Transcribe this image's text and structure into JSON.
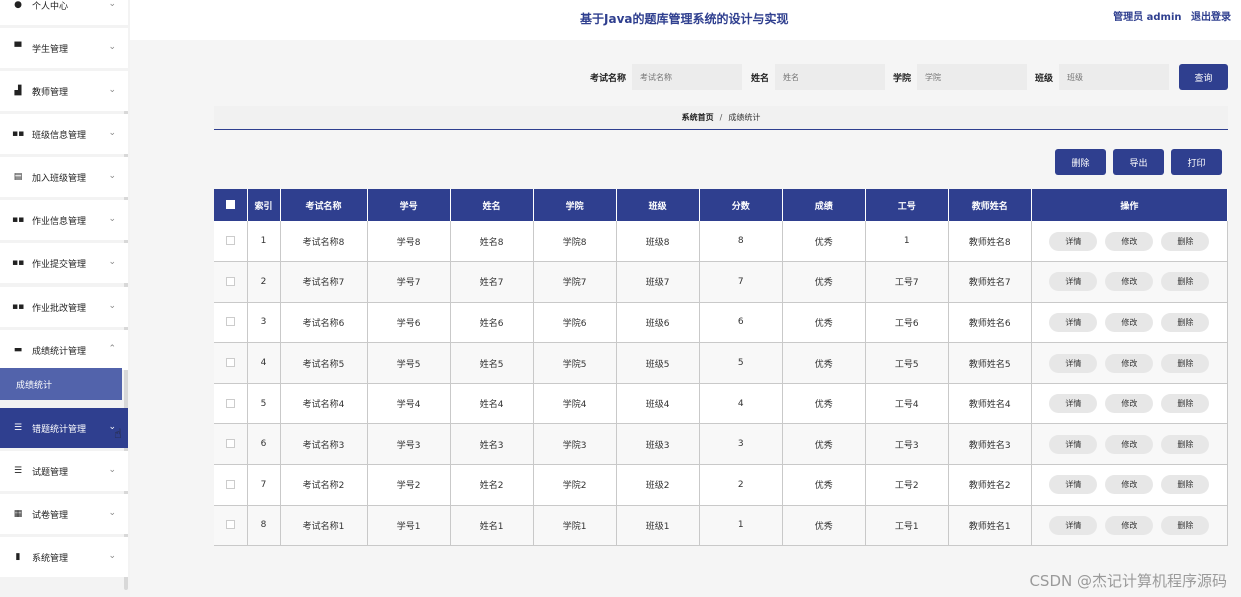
{
  "sidebar": {
    "items": [
      {
        "label": "个人中心",
        "icon": "person-icon",
        "glyph": "●"
      },
      {
        "label": "学生管理",
        "icon": "student-icon",
        "glyph": "▀"
      },
      {
        "label": "教师管理",
        "icon": "teacher-icon",
        "glyph": "▟"
      },
      {
        "label": "班级信息管理",
        "icon": "grid-icon",
        "glyph": "▪▪"
      },
      {
        "label": "加入班级管理",
        "icon": "clipboard-icon",
        "glyph": "▤"
      },
      {
        "label": "作业信息管理",
        "icon": "grid-icon",
        "glyph": "▪▪"
      },
      {
        "label": "作业提交管理",
        "icon": "grid-icon",
        "glyph": "▪▪"
      },
      {
        "label": "作业批改管理",
        "icon": "grid-icon",
        "glyph": "▪▪"
      },
      {
        "label": "成绩统计管理",
        "icon": "chat-icon",
        "glyph": "▬"
      },
      {
        "label": "错题统计管理",
        "icon": "list-icon",
        "glyph": "☰"
      },
      {
        "label": "试题管理",
        "icon": "list-icon",
        "glyph": "☰"
      },
      {
        "label": "试卷管理",
        "icon": "apps-icon",
        "glyph": "▦"
      },
      {
        "label": "系统管理",
        "icon": "chart-icon",
        "glyph": "▮"
      }
    ],
    "sub_item": "成绩统计"
  },
  "header": {
    "title": "基于Java的题库管理系统的设计与实现",
    "user": "管理员 admin",
    "logout": "退出登录"
  },
  "search": {
    "fields": [
      {
        "label": "考试名称",
        "placeholder": "考试名称"
      },
      {
        "label": "姓名",
        "placeholder": "姓名"
      },
      {
        "label": "学院",
        "placeholder": "学院"
      },
      {
        "label": "班级",
        "placeholder": "班级"
      }
    ],
    "query_label": "查询"
  },
  "breadcrumb": {
    "home": "系统首页",
    "sep": "/",
    "current": "成绩统计"
  },
  "toolbar": {
    "delete": "删除",
    "export": "导出",
    "print": "打印"
  },
  "table": {
    "columns": [
      "索引",
      "考试名称",
      "学号",
      "姓名",
      "学院",
      "班级",
      "分数",
      "成绩",
      "工号",
      "教师姓名",
      "操作"
    ],
    "rows": [
      [
        "1",
        "考试名称8",
        "学号8",
        "姓名8",
        "学院8",
        "班级8",
        "8",
        "优秀",
        "1",
        "教师姓名8"
      ],
      [
        "2",
        "考试名称7",
        "学号7",
        "姓名7",
        "学院7",
        "班级7",
        "7",
        "优秀",
        "工号7",
        "教师姓名7"
      ],
      [
        "3",
        "考试名称6",
        "学号6",
        "姓名6",
        "学院6",
        "班级6",
        "6",
        "优秀",
        "工号6",
        "教师姓名6"
      ],
      [
        "4",
        "考试名称5",
        "学号5",
        "姓名5",
        "学院5",
        "班级5",
        "5",
        "优秀",
        "工号5",
        "教师姓名5"
      ],
      [
        "5",
        "考试名称4",
        "学号4",
        "姓名4",
        "学院4",
        "班级4",
        "4",
        "优秀",
        "工号4",
        "教师姓名4"
      ],
      [
        "6",
        "考试名称3",
        "学号3",
        "姓名3",
        "学院3",
        "班级3",
        "3",
        "优秀",
        "工号3",
        "教师姓名3"
      ],
      [
        "7",
        "考试名称2",
        "学号2",
        "姓名2",
        "学院2",
        "班级2",
        "2",
        "优秀",
        "工号2",
        "教师姓名2"
      ],
      [
        "8",
        "考试名称1",
        "学号1",
        "姓名1",
        "学院1",
        "班级1",
        "1",
        "优秀",
        "工号1",
        "教师姓名1"
      ]
    ],
    "actions": [
      "详情",
      "修改",
      "删除"
    ]
  },
  "watermark": "CSDN @杰记计算机程序源码",
  "colors": {
    "primary": "#2f3f8f",
    "sub_active": "#5263ab"
  }
}
